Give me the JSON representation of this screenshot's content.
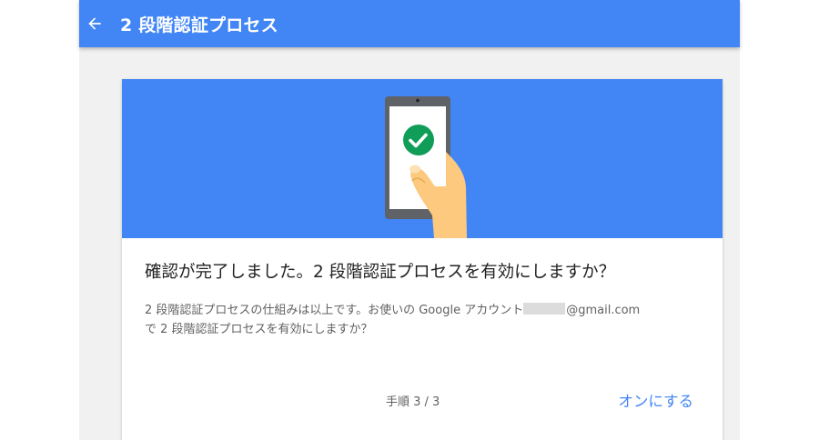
{
  "appbar": {
    "title": "2 段階認証プロセス",
    "back_icon": "arrow-back-icon",
    "background": "#4285f4"
  },
  "hero": {
    "background": "#4285f4",
    "illustration": "phone-with-checkmark-icon",
    "check_color": "#0f9d58"
  },
  "card": {
    "headline": "確認が完了しました。2 段階認証プロセスを有効にしますか？",
    "body_prefix": "2 段階認証プロセスの仕組みは以上です。お使いの Google アカウント",
    "email_suffix": "@gmail.com",
    "body_line2": "で 2 段階認証プロセスを有効にしますか？",
    "step": "手順 3 / 3",
    "action_label": "オンにする",
    "accent": "#4285f4"
  }
}
